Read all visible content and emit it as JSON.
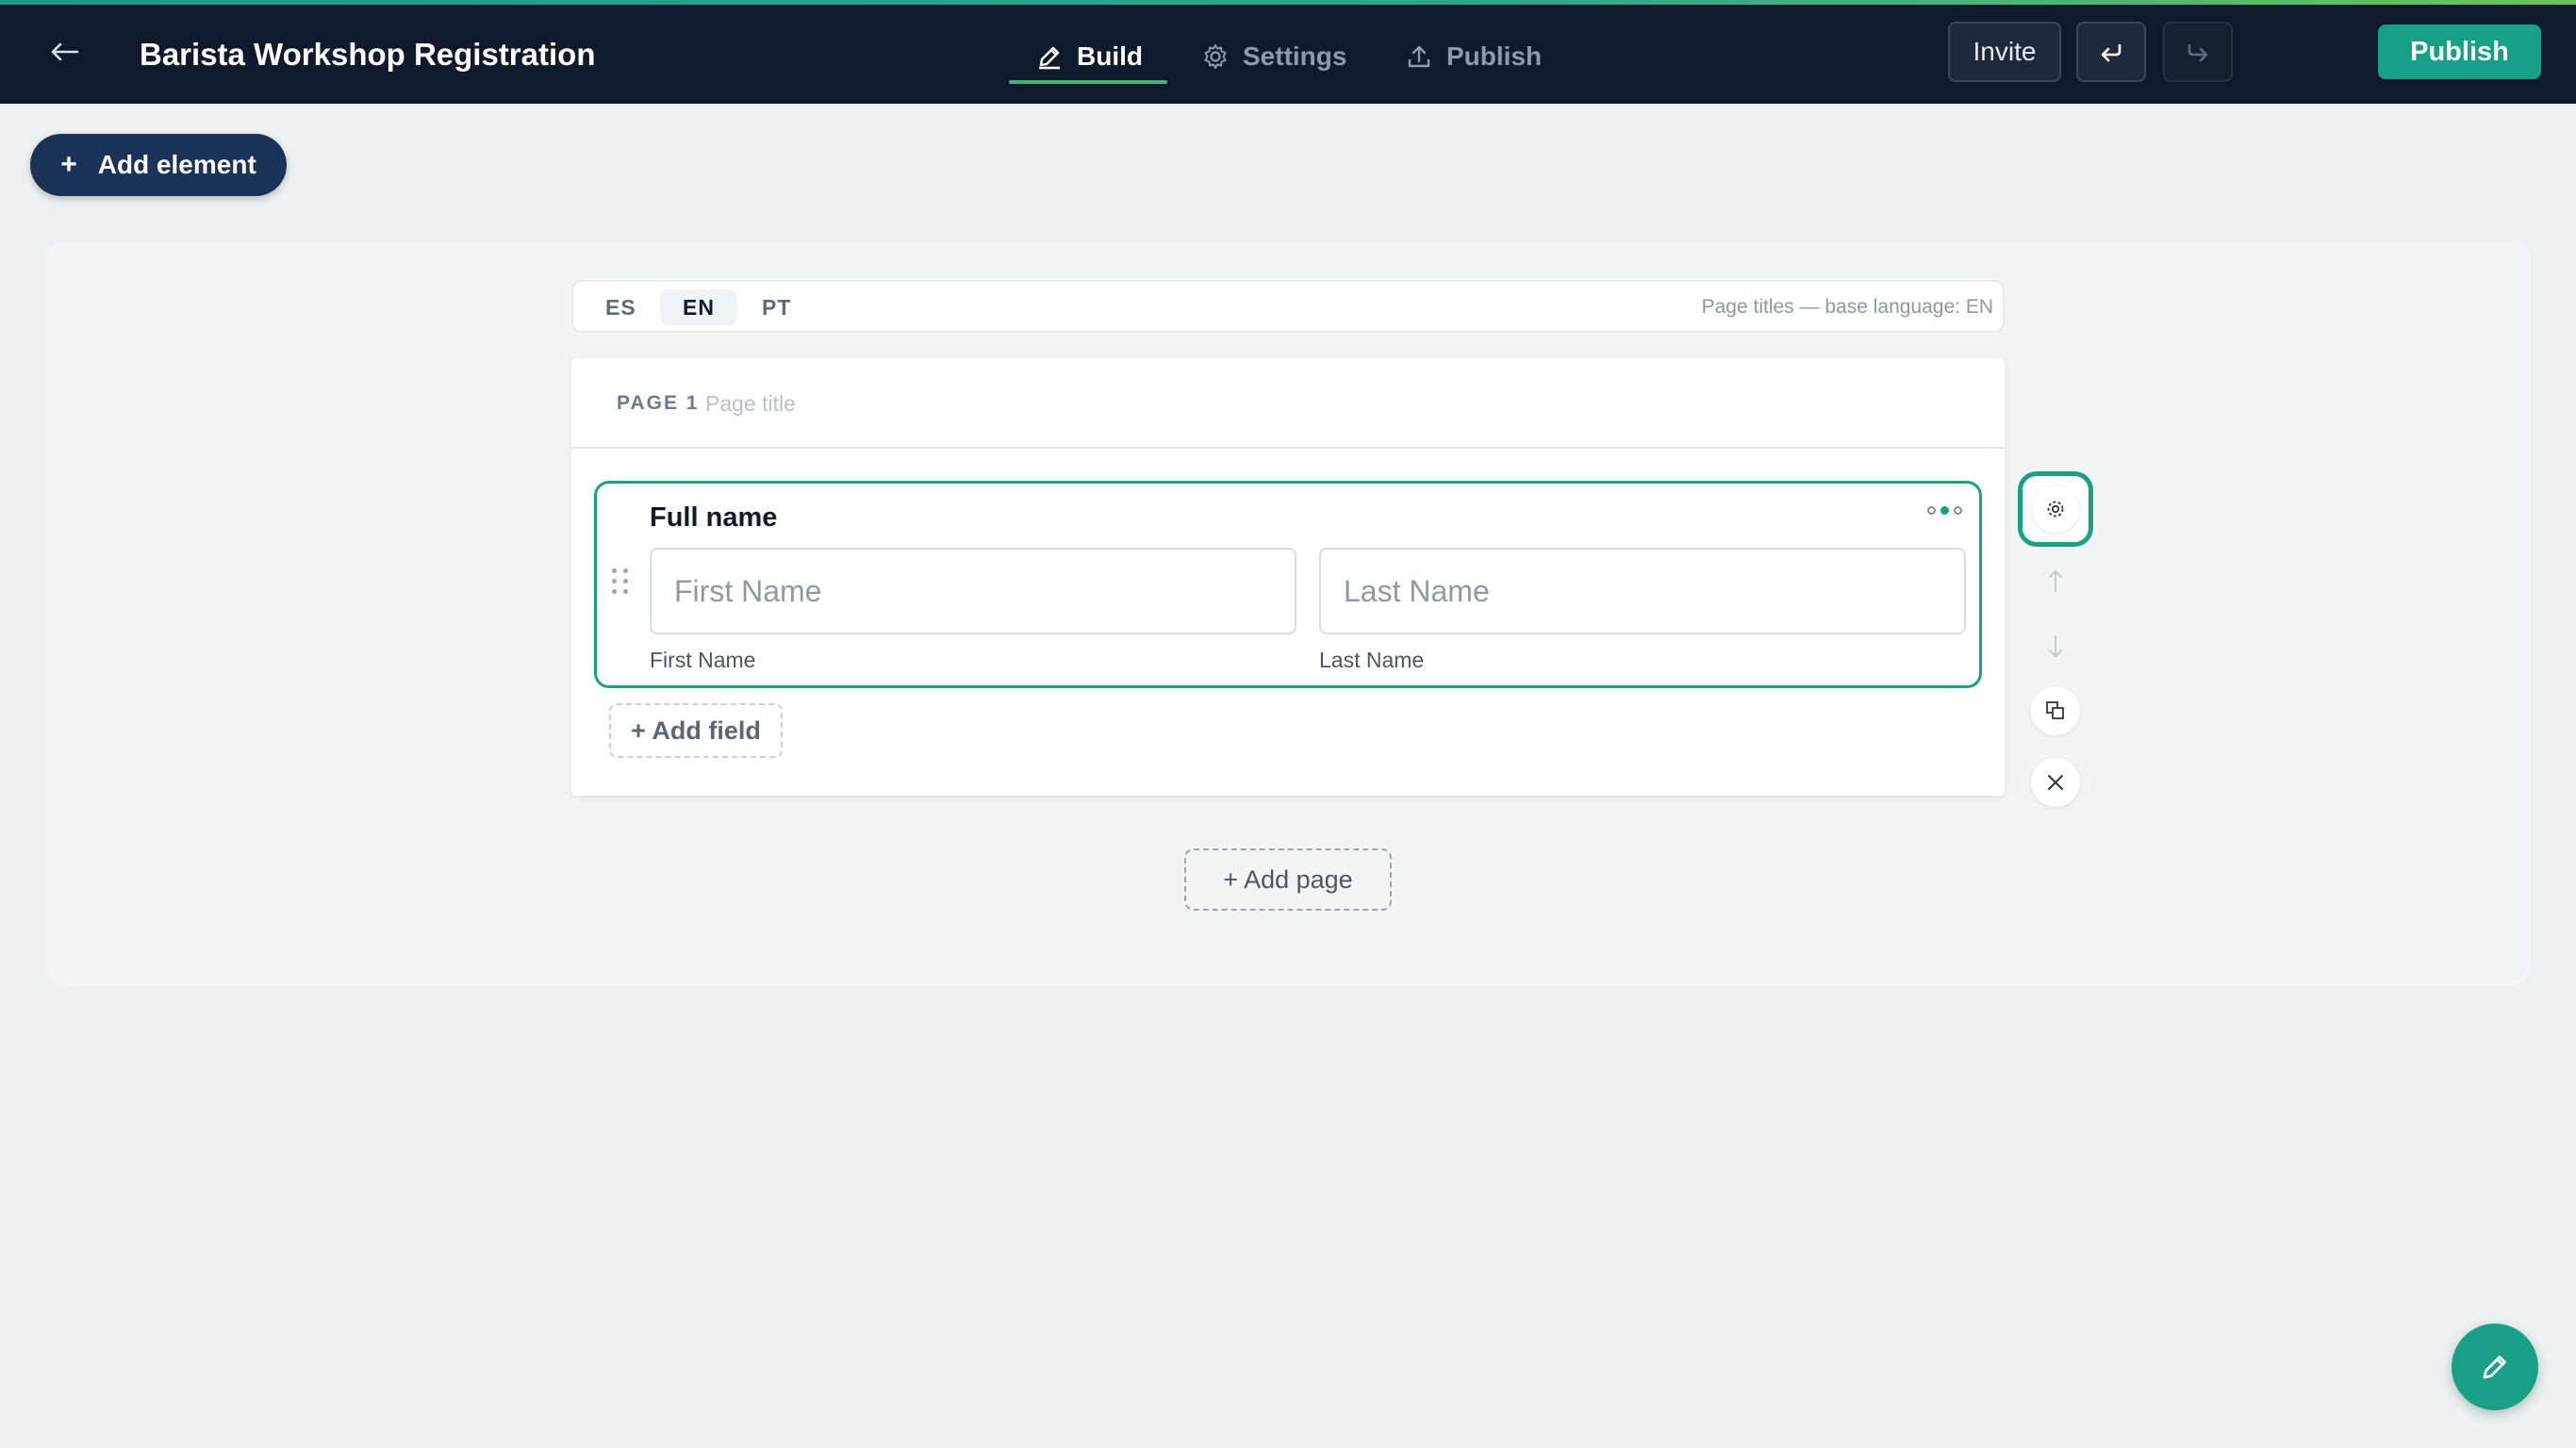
{
  "header": {
    "back_icon": "arrow-left-icon",
    "title": "Barista Workshop Registration",
    "tabs": [
      {
        "label": "Build",
        "icon": "pencil-icon",
        "active": true
      },
      {
        "label": "Settings",
        "icon": "gear-icon",
        "active": false
      },
      {
        "label": "Publish",
        "icon": "upload-icon",
        "active": false
      }
    ],
    "invite_label": "Invite",
    "undo_icon": "undo-icon",
    "redo_icon": "redo-icon",
    "publish_label": "Publish"
  },
  "toolbar": {
    "add_element_label": "Add element",
    "add_element_icon": "+"
  },
  "languages": {
    "items": [
      {
        "code": "ES",
        "active": false
      },
      {
        "code": "EN",
        "active": true
      },
      {
        "code": "PT",
        "active": false
      }
    ],
    "note": "Page titles — base language: EN"
  },
  "page": {
    "label": "PAGE 1",
    "title_placeholder": "Page title",
    "field": {
      "title": "Full name",
      "first_placeholder": "First Name",
      "last_placeholder": "Last Name",
      "first_sublabel": "First Name",
      "last_sublabel": "Last Name"
    },
    "add_field_label": "+ Add field"
  },
  "add_page_label": "+ Add page",
  "colors": {
    "accent": "#1aa086",
    "topbar": "#0f1b2d",
    "add_element": "#1b3358"
  }
}
